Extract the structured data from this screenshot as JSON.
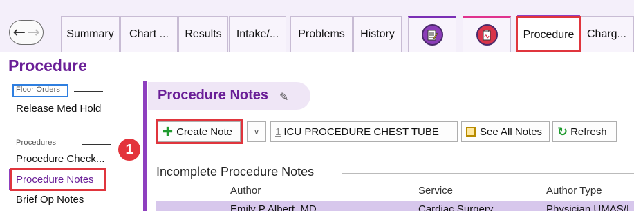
{
  "tabs": {
    "items": [
      "Summary",
      "Chart ...",
      "Results",
      "Intake/...",
      "Problems",
      "History",
      "Procedure",
      "Charg..."
    ],
    "active": "Procedure"
  },
  "page_title": "Procedure",
  "sidebar": {
    "floor_orders_header": "Floor Orders",
    "floor_items": [
      "Release Med Hold"
    ],
    "procedures_header": "Procedures",
    "procedure_items": [
      "Procedure Check...",
      "Procedure Notes",
      "Brief Op Notes"
    ],
    "active_item": "Procedure Notes"
  },
  "badge": "1",
  "main": {
    "title": "Procedure Notes",
    "toolbar": {
      "create_note": "Create Note",
      "dropdown": "∨",
      "shortcut_number": "1",
      "shortcut_label": "ICU PROCEDURE CHEST TUBE",
      "see_all": "See All Notes",
      "refresh": "Refresh"
    },
    "section_title": "Incomplete Procedure Notes",
    "columns": [
      "Author",
      "Service",
      "Author Type"
    ],
    "rows": [
      {
        "author": "Emily P Albert, MD",
        "service": "Cardiac Surgery",
        "author_type": "Physician UMAS/I"
      }
    ]
  },
  "colors": {
    "accent": "#6a1f97",
    "highlight_box": "#e0353d",
    "selection_box": "#2f7fe0",
    "row_highlight": "#d7c7ec"
  },
  "icons": [
    "back-arrow-icon",
    "forward-arrow-icon",
    "notepad-icon",
    "clipboard-icon",
    "pencil-icon",
    "plus-icon",
    "chevron-down-icon",
    "notes-list-icon",
    "refresh-icon"
  ]
}
